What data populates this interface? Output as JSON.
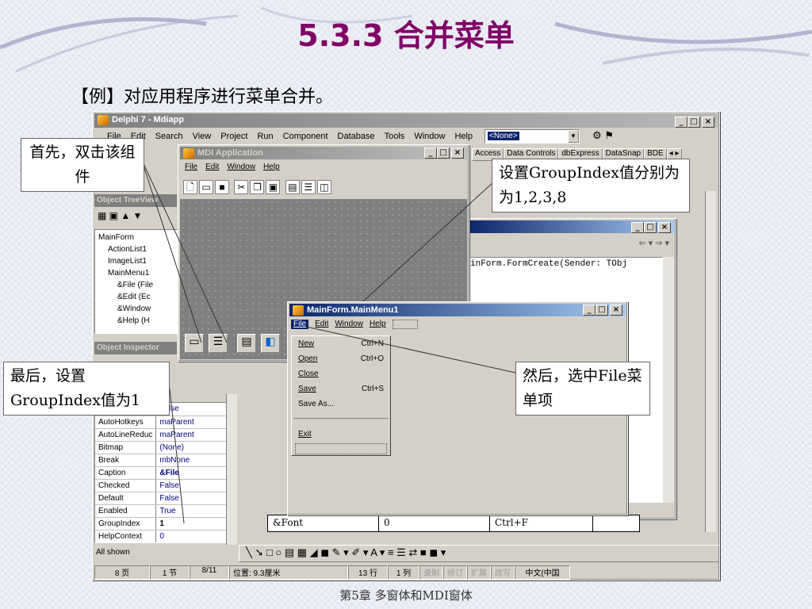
{
  "slide": {
    "title": "5.3.3 合并菜单",
    "intro": "【例】对应用程序进行菜单合并。",
    "footer": "第5章 多窗体和MDI窗体"
  },
  "callouts": {
    "double_click": "首先，双击该组件",
    "set_groupindex": "设置GroupIndex值分别为为1,2,3,8",
    "select_file": "然后，选中File菜单项",
    "finally": "最后，设置GroupIndex值为1"
  },
  "ide": {
    "title": "Delphi 7 - Mdiapp",
    "menu": [
      "File",
      "Edit",
      "Search",
      "View",
      "Project",
      "Run",
      "Component",
      "Database",
      "Tools",
      "Window",
      "Help"
    ],
    "combo_value": "<None>",
    "palette_tabs": [
      "Access",
      "Data Controls",
      "dbExpress",
      "DataSnap",
      "BDE"
    ],
    "treeview_title": "Object TreeView",
    "tree": [
      "MainForm",
      "ActionList1",
      "ImageList1",
      "MainMenu1",
      "&File (File",
      "&Edit (Ec",
      "&Window",
      "&Help (H"
    ],
    "inspector_title": "Object Inspector",
    "inspector_rows": [
      {
        "prop": "AutoCheck",
        "value": "False"
      },
      {
        "prop": "AutoHotkeys",
        "value": "maParent"
      },
      {
        "prop": "AutoLineReduc",
        "value": "maParent"
      },
      {
        "prop": "Bitmap",
        "value": "(None)"
      },
      {
        "prop": "Break",
        "value": "mbNone"
      },
      {
        "prop": "Caption",
        "value": "&File"
      },
      {
        "prop": "Checked",
        "value": "False"
      },
      {
        "prop": "Default",
        "value": "False"
      },
      {
        "prop": "Enabled",
        "value": "True"
      },
      {
        "prop": "GroupIndex",
        "value": "1"
      },
      {
        "prop": "HelpContext",
        "value": "0"
      }
    ],
    "all_shown": "All shown",
    "code_line": "inForm.FormCreate(Sender: TObj",
    "table_cells": [
      "&Font",
      "0",
      "Ctrl+F"
    ]
  },
  "mdi": {
    "title": "MDI Application",
    "menu": [
      "File",
      "Edit",
      "Window",
      "Help"
    ]
  },
  "designer": {
    "title": "MainForm.MainMenu1",
    "menu": [
      "File",
      "Edit",
      "Window",
      "Help"
    ],
    "items": [
      {
        "label": "New",
        "shortcut": "Ctrl+N"
      },
      {
        "label": "Open",
        "shortcut": "Ctrl+O"
      },
      {
        "label": "Close",
        "shortcut": ""
      },
      {
        "label": "Save",
        "shortcut": "Ctrl+S"
      },
      {
        "label": "Save As...",
        "shortcut": ""
      },
      {
        "label": "Exit",
        "shortcut": ""
      }
    ]
  },
  "statusbar": {
    "page": "8 页",
    "section": "1 节",
    "pages": "8/11",
    "position": "位置: 9.3厘米",
    "line": "13 行",
    "col": "1 列",
    "modes": [
      "录制",
      "修订",
      "扩展",
      "改写"
    ],
    "lang": "中文(中国"
  }
}
